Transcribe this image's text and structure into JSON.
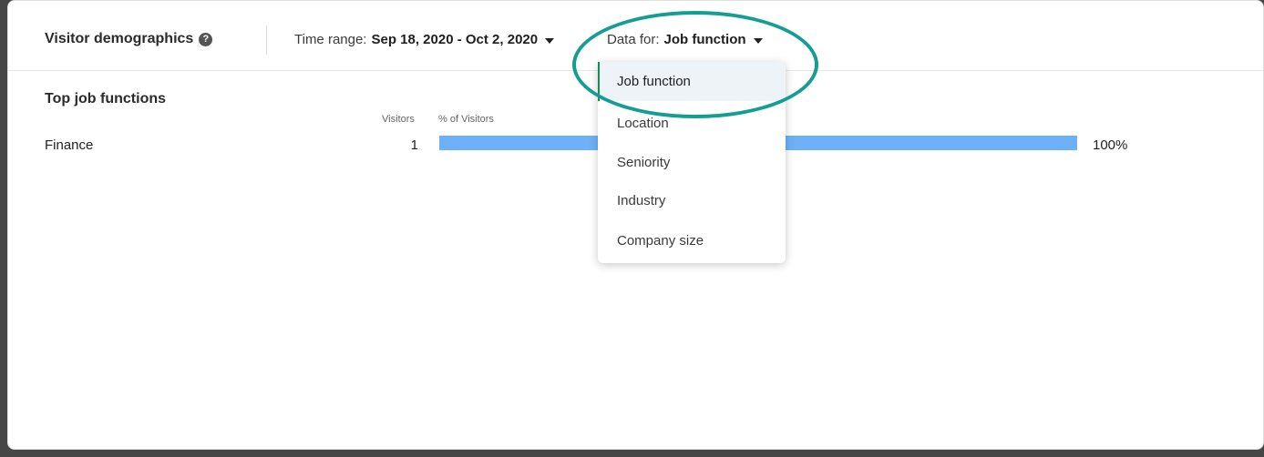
{
  "header": {
    "title": "Visitor demographics",
    "help_icon": "?",
    "time_range": {
      "label": "Time range:",
      "value": "Sep 18, 2020 - Oct 2, 2020"
    },
    "data_for": {
      "label": "Data for:",
      "value": "Job function"
    }
  },
  "section": {
    "title": "Top job functions",
    "columns": {
      "visitors": "Visitors",
      "percent": "% of Visitors"
    },
    "rows": [
      {
        "label": "Finance",
        "count": "1",
        "percent_text": "100%",
        "percent_value": 100
      }
    ]
  },
  "dropdown": {
    "selected": "Job function",
    "options": [
      "Job function",
      "Location",
      "Seniority",
      "Industry",
      "Company size"
    ]
  },
  "colors": {
    "bar": "#6fb1f9",
    "highlight_ring": "#139d93",
    "selected_indicator": "#1b8a5a"
  }
}
